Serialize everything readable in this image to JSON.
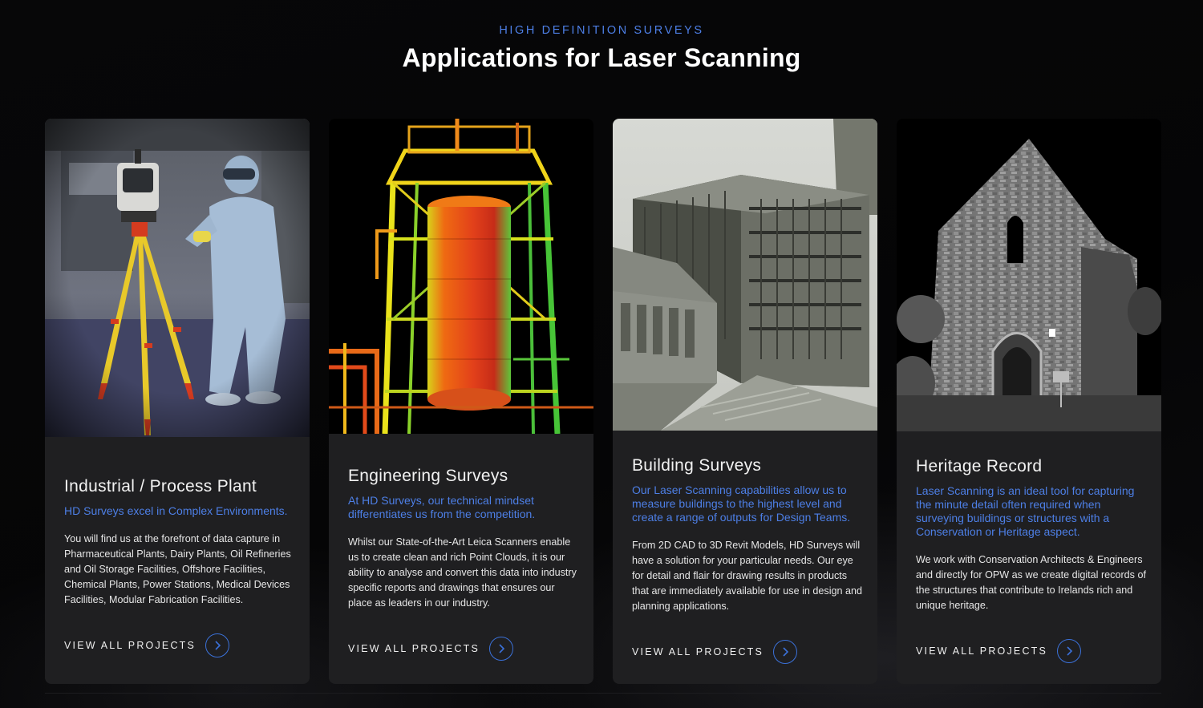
{
  "section": {
    "eyebrow": "HIGH DEFINITION SURVEYS",
    "title": "Applications for Laser Scanning"
  },
  "cards": [
    {
      "image_alt": "laser scanner on tripod in cleanroom",
      "title": "Industrial / Process Plant",
      "lead": "HD Surveys excel in Complex Environments.",
      "text": "You will find us at the forefront of data capture in Pharmaceutical Plants, Dairy Plants, Oil Refineries and Oil Storage Facilities, Offshore Facilities, Chemical Plants, Power Stations, Medical Devices Facilities, Modular Fabrication Facilities.",
      "cta": "VIEW ALL PROJECTS",
      "cta_icon": "chevron-right-icon"
    },
    {
      "image_alt": "colored point cloud of storage tank",
      "title": "Engineering Surveys",
      "lead": "At HD Surveys, our technical mindset differentiates us from the competition.",
      "text": "Whilst our State-of-the-Art Leica Scanners enable us to create clean and rich Point Clouds, it is our ability to analyse and convert this data into industry specific reports and drawings that ensures our place as leaders in our industry.",
      "cta": "VIEW ALL PROJECTS",
      "cta_icon": "chevron-right-icon"
    },
    {
      "image_alt": "3D model of office buildings",
      "title": "Building Surveys",
      "lead": "Our Laser Scanning capabilities allow us to measure buildings to the highest level and create a range of outputs for Design Teams.",
      "text": "From 2D CAD to 3D Revit Models, HD Surveys will have a solution for your particular needs. Our eye for detail and flair for drawing results in products that are immediately available for use in design and planning applications.",
      "cta": "VIEW ALL PROJECTS",
      "cta_icon": "chevron-right-icon"
    },
    {
      "image_alt": "point cloud of ruined church gable",
      "title": "Heritage Record",
      "lead": "Laser Scanning is an ideal tool for capturing the minute detail often required when surveying buildings or structures with a Conservation or Heritage aspect.",
      "text": "We work with Conservation Architects & Engineers and directly for OPW as we create digital records of the structures that contribute to Irelands rich and unique heritage.",
      "cta": "VIEW ALL PROJECTS",
      "cta_icon": "chevron-right-icon"
    }
  ],
  "colors": {
    "accent": "#4d7fe6",
    "card_bg": "#1f1f21",
    "page_bg": "#050506"
  }
}
